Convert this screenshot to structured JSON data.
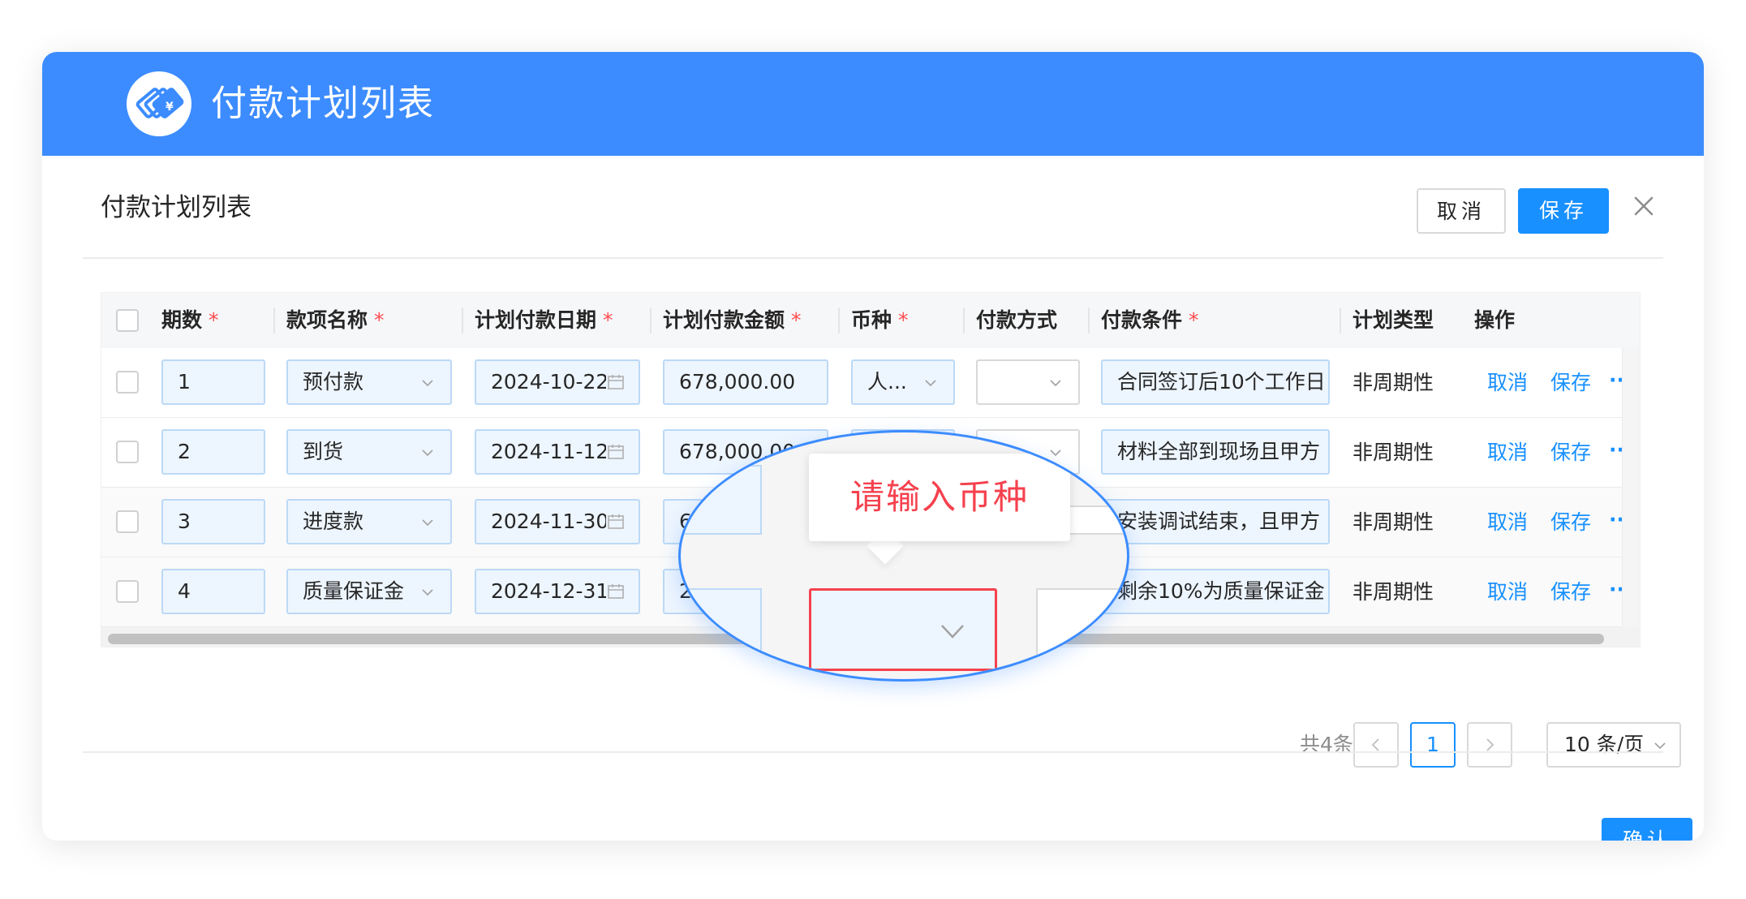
{
  "banner": {
    "title": "付款计划列表"
  },
  "dialog": {
    "title": "付款计划列表",
    "cancel_label": "取消",
    "save_label": "保存",
    "confirm_label": "确认"
  },
  "table": {
    "columns": [
      {
        "label": "期数",
        "required": "*"
      },
      {
        "label": "款项名称",
        "required": "*"
      },
      {
        "label": "计划付款日期",
        "required": "*"
      },
      {
        "label": "计划付款金额",
        "required": "*"
      },
      {
        "label": "币种",
        "required": "*"
      },
      {
        "label": "付款方式",
        "required": ""
      },
      {
        "label": "付款条件",
        "required": "*"
      },
      {
        "label": "计划类型",
        "required": ""
      },
      {
        "label": "操作",
        "required": ""
      }
    ],
    "rows": [
      {
        "period": "1",
        "name": "预付款",
        "date": "2024-10-22",
        "amount": "678,000.00",
        "currency": "人...",
        "method": "",
        "condition": "合同签订后10个工作日",
        "type": "非周期性",
        "cancel": "取消",
        "save": "保存",
        "more": "··"
      },
      {
        "period": "2",
        "name": "到货",
        "date": "2024-11-12",
        "amount": "678,000.00",
        "currency": "",
        "method": "",
        "condition": "材料全部到现场且甲方",
        "type": "非周期性",
        "cancel": "取消",
        "save": "保存",
        "more": "··"
      },
      {
        "period": "3",
        "name": "进度款",
        "date": "2024-11-30",
        "amount": "6",
        "currency": "",
        "method": "",
        "condition": "安装调试结束，且甲方",
        "type": "非周期性",
        "cancel": "取消",
        "save": "保存",
        "more": "··"
      },
      {
        "period": "4",
        "name": "质量保证金",
        "date": "2024-12-31",
        "amount": "2",
        "currency": "",
        "method": "",
        "condition": "剩余10%为质量保证金",
        "type": "非周期性",
        "cancel": "取消",
        "save": "保存",
        "more": "··"
      }
    ]
  },
  "pagination": {
    "total": "共4条",
    "prev": "<",
    "current": "1",
    "next": ">",
    "page_size": "10 条/页"
  },
  "magnifier": {
    "tooltip": "请输入币种"
  },
  "colors": {
    "primary": "#1890ff",
    "banner": "#3c8cff",
    "error": "#f5414e",
    "required": "#ff4d4f"
  }
}
